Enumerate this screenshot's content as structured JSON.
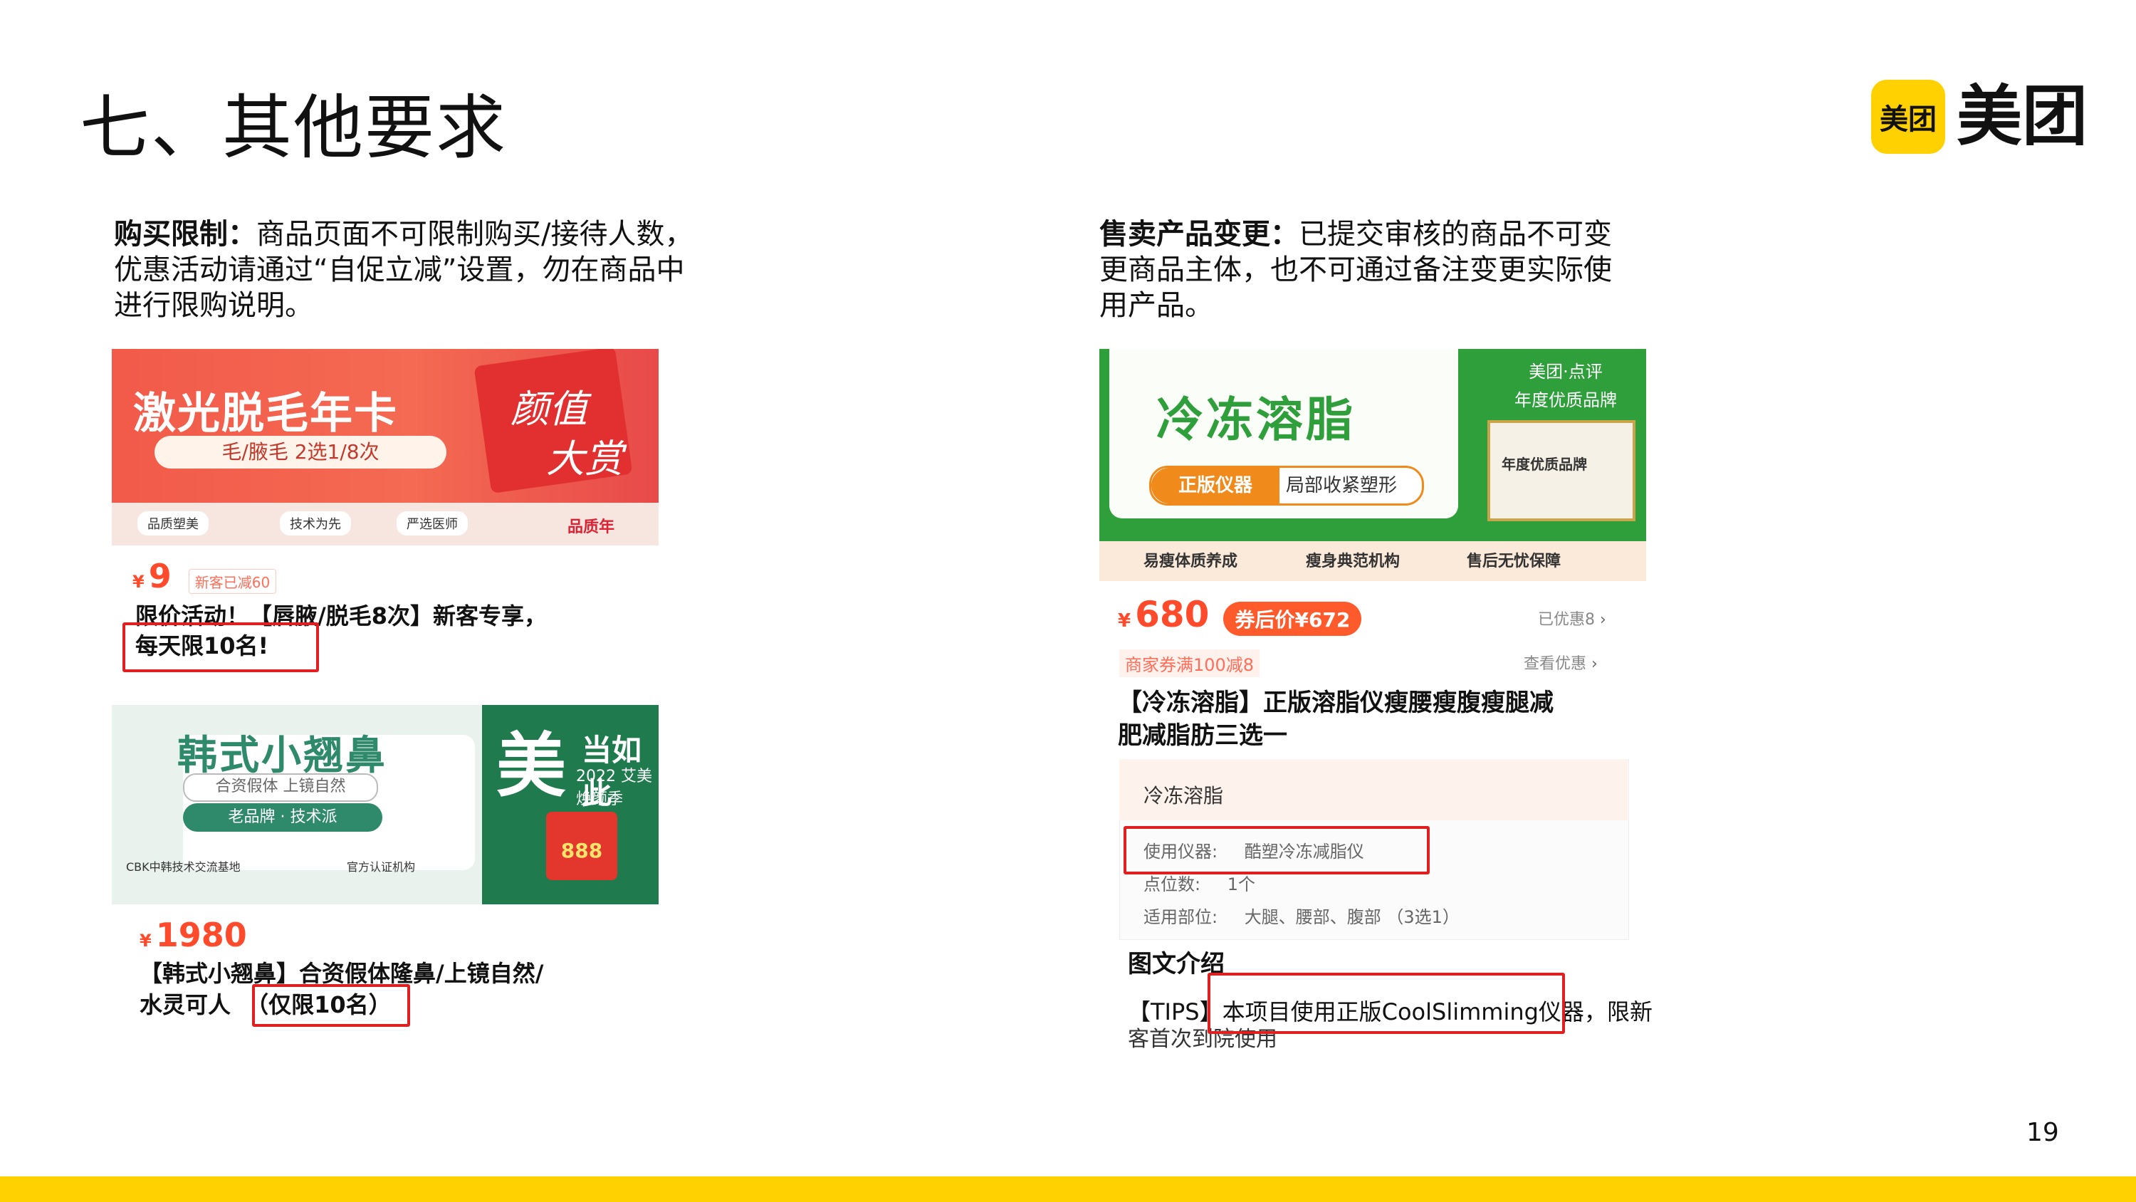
{
  "page": {
    "title": "七、其他要求",
    "page_number": "19",
    "accent_color": "#ffd100"
  },
  "logo": {
    "mark": "美团",
    "text": "美团"
  },
  "left": {
    "heading_bold": "购买限制",
    "heading_colon": "：",
    "para_line1": "商品页面不可限制购买/接待人数，",
    "para_line2": "优惠活动请通过“自促立减”设置，勿在商品中",
    "para_line3": "进行限购说明。",
    "product1": {
      "banner_title": "激光脱毛年卡",
      "banner_sub": "毛/腋毛 2选1/8次",
      "banner_deco1": "颜值",
      "banner_deco2": "大赏",
      "tags": [
        "品质塑美",
        "技术为先",
        "严选医师"
      ],
      "banner_footer": "品质年",
      "currency": "¥",
      "price": "9",
      "coupon": "新客已减60",
      "title_line1": "限价活动！【唇腋/脱毛8次】新客专享，",
      "title_highlight": "每天限10名!"
    },
    "product2": {
      "banner_title": "韩式小翘鼻",
      "pill1": "合资假体 上镜自然",
      "pill2": "老品牌 · 技术派",
      "mei": "美",
      "dang": "当如此",
      "year": "2022 艾美焕颜季",
      "box": "888",
      "foot1": "CBK中韩技术交流基地",
      "foot2": "官方认证机构",
      "currency": "¥",
      "price": "1980",
      "title_line1": "【韩式小翘鼻】合资假体隆鼻/上镜自然/",
      "title_line2": "水灵可人",
      "title_highlight": "（仅限10名）"
    }
  },
  "right": {
    "heading_bold": "售卖产品变更",
    "heading_colon": "：",
    "para_line1": "已提交审核的商品不可变",
    "para_line2": "更商品主体，也不可通过备注变更实际使",
    "para_line3": "用产品。",
    "product": {
      "banner_title": "冷冻溶脂",
      "pill_a": "正版仪器",
      "pill_b": "局部收紧塑形",
      "brand_line1": "美团·点评",
      "brand_line2": "年度优质品牌",
      "cert": "年度优质品牌",
      "tags": [
        "易瘦体质养成",
        "瘦身典范机构",
        "售后无忧保障"
      ],
      "currency": "¥",
      "price": "680",
      "after_coupon": "券后价¥672",
      "discount": "已优惠8",
      "merchant_coupon": "商家券满100减8",
      "view_offers": "查看优惠",
      "title_line1": "【冷冻溶脂】正版溶脂仪瘦腰瘦腹瘦腿减",
      "title_line2": "肥减脂肪三选一",
      "panel_head": "冷冻溶脂",
      "spec1_label": "使用仪器:",
      "spec1_value": "酷塑冷冻减脂仪",
      "spec2_label": "点位数:",
      "spec2_value": "1个",
      "spec3_label": "适用部位:",
      "spec3_value": "大腿、腰部、腹部 （3选1）",
      "intro_title": "图文介绍",
      "tips_prefix": "【TIPS】",
      "tips_highlight": "本项目使用正版CoolSlimming仪器，",
      "tips_suffix": "限新",
      "tips_line2": "客首次到院使用"
    }
  }
}
